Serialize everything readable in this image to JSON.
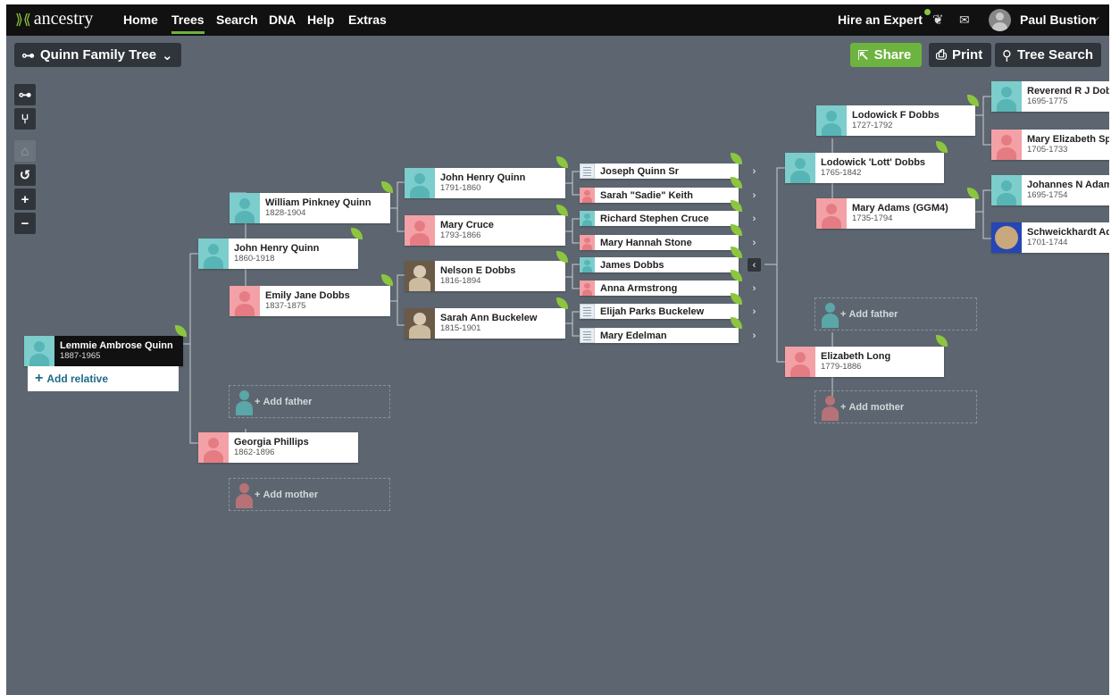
{
  "nav": {
    "logo": "ancestry",
    "items": [
      "Home",
      "Trees",
      "Search",
      "DNA",
      "Help",
      "Extras"
    ],
    "active": "Trees",
    "hire": "Hire an Expert",
    "user": "Paul Bustion"
  },
  "toolbar": {
    "tree_name": "Quinn Family Tree",
    "share": "Share",
    "print": "Print",
    "tree_search": "Tree Search"
  },
  "tree": {
    "root": {
      "name": "Lemmie Ambrose Quinn",
      "years": "1887-1965"
    },
    "add_relative": "Add relative",
    "add_father": "Add father",
    "add_mother": "Add mother",
    "people": {
      "john_henry_1860": {
        "name": "John Henry Quinn",
        "years": "1860-1918"
      },
      "georgia_phillips": {
        "name": "Georgia Phillips",
        "years": "1862-1896"
      },
      "william_pinkney": {
        "name": "William Pinkney Quinn",
        "years": "1828-1904"
      },
      "emily_jane": {
        "name": "Emily Jane Dobbs",
        "years": "1837-1875"
      },
      "john_henry_1791": {
        "name": "John Henry Quinn",
        "years": "1791-1860"
      },
      "mary_cruce": {
        "name": "Mary Cruce",
        "years": "1793-1866"
      },
      "nelson_dobbs": {
        "name": "Nelson E Dobbs",
        "years": "1816-1894"
      },
      "sarah_ann": {
        "name": "Sarah Ann Buckelew",
        "years": "1815-1901"
      },
      "joseph_quinn": {
        "name": "Joseph Quinn Sr"
      },
      "sarah_keith": {
        "name": "Sarah \"Sadie\" Keith"
      },
      "richard_cruce": {
        "name": "Richard Stephen Cruce"
      },
      "mary_hannah": {
        "name": "Mary Hannah Stone"
      },
      "james_dobbs": {
        "name": "James Dobbs"
      },
      "anna_armstrong": {
        "name": "Anna Armstrong"
      },
      "elijah": {
        "name": "Elijah Parks Buckelew"
      },
      "mary_edelman": {
        "name": "Mary Edelman"
      },
      "lodowick_lott": {
        "name": "Lodowick 'Lott' Dobbs",
        "years": "1765-1842"
      },
      "elizabeth_long": {
        "name": "Elizabeth Long",
        "years": "1779-1886"
      },
      "lodowick_f": {
        "name": "Lodowick F Dobbs",
        "years": "1727-1792"
      },
      "mary_adams": {
        "name": "Mary Adams (GGM4)",
        "years": "1735-1794"
      },
      "reverend": {
        "name": "Reverend R J Dobb",
        "years": "1695-1775"
      },
      "mary_elizabeth": {
        "name": "Mary Elizabeth Spe",
        "years": "1705-1733"
      },
      "johannes": {
        "name": "Johannes N Adam",
        "years": "1695-1754"
      },
      "schweickhardt": {
        "name": "Schweickhardt Ada",
        "years": "1701-1744"
      }
    }
  }
}
